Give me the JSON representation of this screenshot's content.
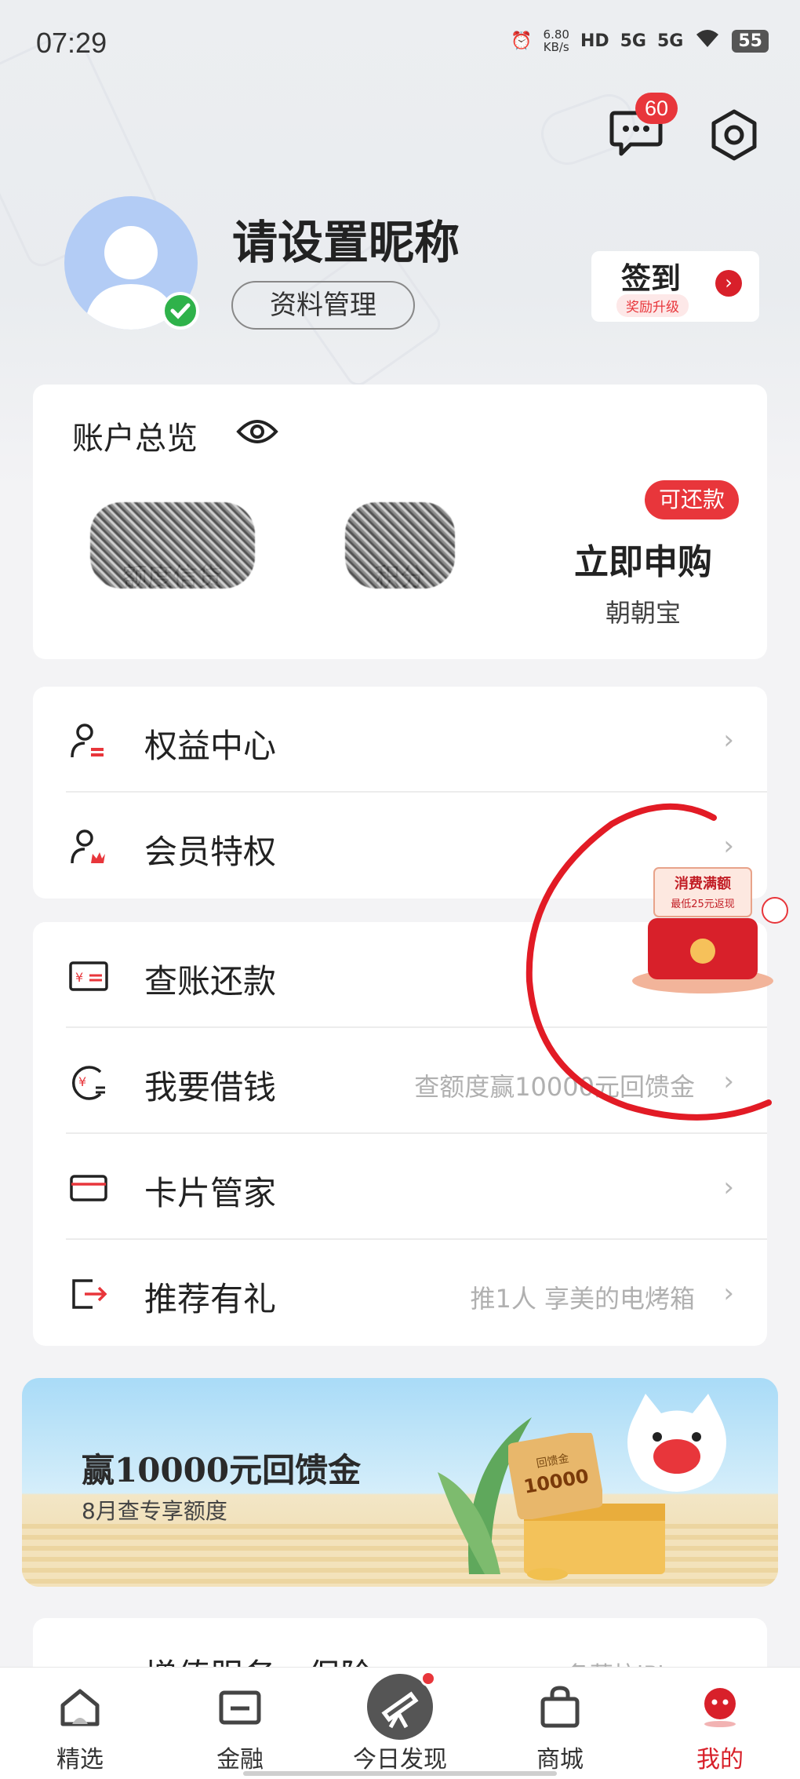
{
  "status_bar": {
    "time": "07:29",
    "speed_value": "6.80",
    "speed_unit": "KB/s",
    "hd": "HD",
    "net1": "5G",
    "net2": "5G",
    "battery": "55"
  },
  "header": {
    "message_badge": "60"
  },
  "profile": {
    "nickname": "请设置昵称",
    "profile_button": "资料管理",
    "signin_title": "签到",
    "signin_sub": "奖励升级"
  },
  "account": {
    "title": "账户总览",
    "items": [
      {
        "label": "额度信贷",
        "value": ""
      },
      {
        "label": "积分",
        "value": ""
      },
      {
        "label": "朝朝宝",
        "value": "立即申购"
      }
    ],
    "badge": "可还款"
  },
  "menu_group_1": [
    {
      "label": "权益中心",
      "sub": ""
    },
    {
      "label": "会员特权",
      "sub": ""
    }
  ],
  "menu_group_2": [
    {
      "label": "查账还款",
      "sub": ""
    },
    {
      "label": "我要借钱",
      "sub": "查额度赢10000元回馈金"
    },
    {
      "label": "卡片管家",
      "sub": ""
    },
    {
      "label": "推荐有礼",
      "sub": "推1人 享美的电烤箱"
    }
  ],
  "floating_promo": {
    "title": "消费满额",
    "sub": "最低25元返现"
  },
  "banner": {
    "title": "赢10000元回馈金",
    "sub": "8月查专享额度",
    "ticket_label": "回馈金",
    "ticket_amount": "10000"
  },
  "peek_row": {
    "label": "增值服务 · 保险",
    "sub": "备蓄抗iPh..."
  },
  "bottom_nav": [
    {
      "label": "精选",
      "icon": "home-icon"
    },
    {
      "label": "金融",
      "icon": "wallet-icon"
    },
    {
      "label": "今日发现",
      "icon": "telescope-icon"
    },
    {
      "label": "商城",
      "icon": "bag-icon"
    },
    {
      "label": "我的",
      "icon": "me-icon"
    }
  ],
  "colors": {
    "accent_red": "#e8363b",
    "nav_active": "#d8202a",
    "verified_green": "#2fb24a"
  }
}
